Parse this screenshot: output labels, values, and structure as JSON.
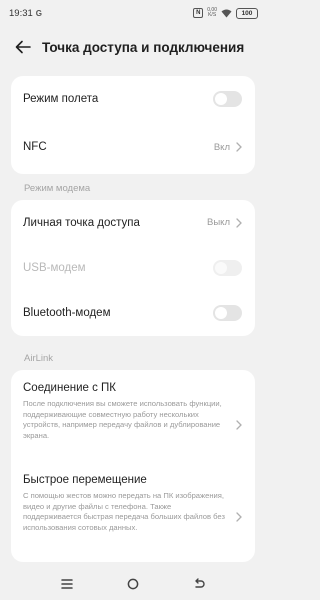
{
  "status_bar": {
    "time": "19:31",
    "carrier_icon_text": "G",
    "nfc_icon_text": "N",
    "speed_value": "0,00",
    "speed_unit": "K/S",
    "battery": "100"
  },
  "header": {
    "title": "Точка доступа и подключения"
  },
  "card1": {
    "airplane_label": "Режим полета",
    "airplane_on": false,
    "nfc_label": "NFC",
    "nfc_value": "Вкл"
  },
  "section_modem": {
    "title": "Режим модема"
  },
  "card2": {
    "hotspot_label": "Личная точка доступа",
    "hotspot_value": "Выкл",
    "usb_label": "USB-модем",
    "usb_enabled": false,
    "bluetooth_label": "Bluetooth-модем",
    "bluetooth_on": false
  },
  "section_airlink": {
    "title": "AirLink"
  },
  "card3": {
    "pc_title": "Соединение с ПК",
    "pc_desc": "После подключения вы сможете использовать функции, поддерживающие совместную работу нескольких устройств, например передачу файлов и дублирование экрана.",
    "transfer_title": "Быстрое перемещение",
    "transfer_desc": "С помощью жестов можно передать на ПК изображения, видео и другие файлы с телефона. Также поддерживается быстрая передача больших файлов без использования сотовых данных."
  },
  "colors": {
    "background": "#f1f1f1",
    "card": "#ffffff",
    "toggle_off": "#e4e4e4",
    "secondary_text": "#9a9a9a"
  }
}
